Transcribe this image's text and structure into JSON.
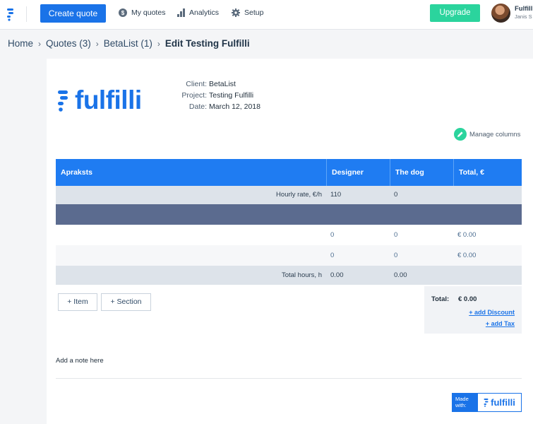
{
  "nav": {
    "create_quote": "Create quote",
    "my_quotes": "My quotes",
    "analytics": "Analytics",
    "setup": "Setup",
    "upgrade": "Upgrade",
    "user_name": "Fulfilli",
    "user_sub": "Janis S",
    "accent": "#1a73e8",
    "upgrade_color": "#2bd49d"
  },
  "breadcrumb": {
    "items": [
      "Home",
      "Quotes (3)",
      "BetaList (1)"
    ],
    "current": "Edit Testing Fulfilli"
  },
  "quote": {
    "brand": "fulfilli",
    "labels": {
      "client": "Client:",
      "project": "Project:",
      "date": "Date:"
    },
    "values": {
      "client": "BetaList",
      "project": "Testing Fulfilli",
      "date": "March 12, 2018"
    },
    "manage_columns": "Manage columns"
  },
  "table": {
    "headers": [
      "Apraksts",
      "Designer",
      "The dog",
      "Total, €"
    ],
    "rate_row": {
      "label": "Hourly rate, €/h",
      "designer": "110",
      "dog": "0"
    },
    "items": [
      {
        "designer": "0",
        "dog": "0",
        "total": "€ 0.00"
      },
      {
        "designer": "0",
        "dog": "0",
        "total": "€ 0.00"
      }
    ],
    "totals_row": {
      "label": "Total hours, h",
      "designer": "0.00",
      "dog": "0.00"
    },
    "header_color": "#1f7cf2",
    "section_color": "#5b6b8f"
  },
  "actions": {
    "add_item": "+ Item",
    "add_section": "+ Section"
  },
  "summary": {
    "total_label": "Total:",
    "total_value": "€ 0.00",
    "add_discount": "+ add Discount",
    "add_tax": "+ add Tax"
  },
  "note": "Add a note here",
  "footer": {
    "made_with_1": "Made",
    "made_with_2": "with:",
    "brand": "fulfilli"
  }
}
